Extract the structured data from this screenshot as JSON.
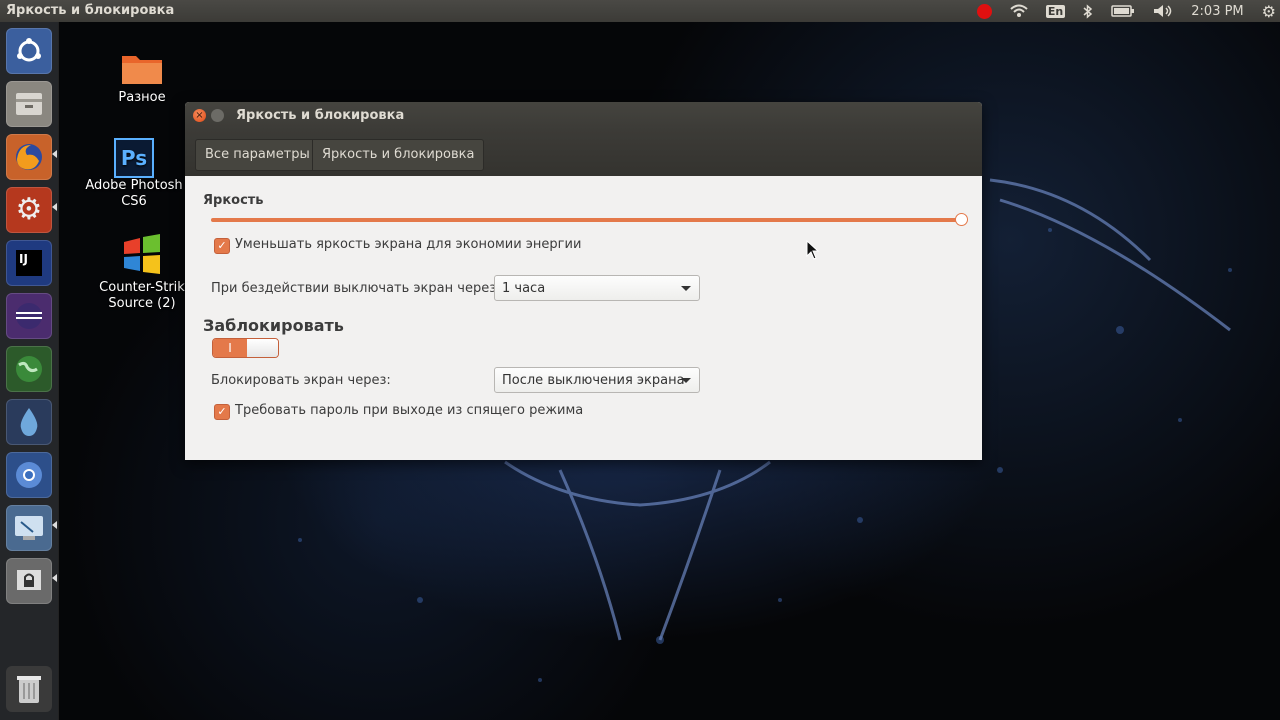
{
  "top_panel": {
    "app_title": "Яркость и блокировка",
    "keyboard_layout": "En",
    "clock": "2:03 PM"
  },
  "launcher": {
    "items": [
      "ubuntu-dash",
      "files",
      "firefox",
      "system-settings",
      "intellij-idea",
      "eclipse",
      "network",
      "water-drop",
      "chromium",
      "screen-capture",
      "lock-screen"
    ],
    "bottom": "trash"
  },
  "desktop_icons": [
    {
      "label": "Разное",
      "icon": "folder-icon"
    },
    {
      "label": "Adobe Photosh CS6",
      "line1": "Adobe Photosh",
      "line2": "CS6",
      "icon": "photoshop-icon"
    },
    {
      "label": "Counter-Strike Source (2)",
      "line1": "Counter-Strik",
      "line2": "Source (2)",
      "icon": "windows-icon"
    }
  ],
  "window": {
    "title": "Яркость и блокировка",
    "breadcrumb": [
      "Все параметры",
      "Яркость и блокировка"
    ],
    "brightness": {
      "heading": "Яркость",
      "level": 1.0,
      "dim_label": "Уменьшать яркость экрана для экономии энергии",
      "dim_checked": true,
      "idle_label": "При бездействии выключать экран через:",
      "idle_value": "1 часа"
    },
    "lock": {
      "heading": "Заблокировать",
      "toggle_on_glyph": "I",
      "enabled": true,
      "lock_after_label": "Блокировать экран через:",
      "lock_after_value": "После выключения экрана",
      "require_password_label": "Требовать пароль при выходе из спящего режима",
      "require_password_checked": true
    }
  },
  "colors": {
    "accent": "#e4794a",
    "panel": "#3c3b37",
    "window_bg": "#f2f1f0"
  }
}
